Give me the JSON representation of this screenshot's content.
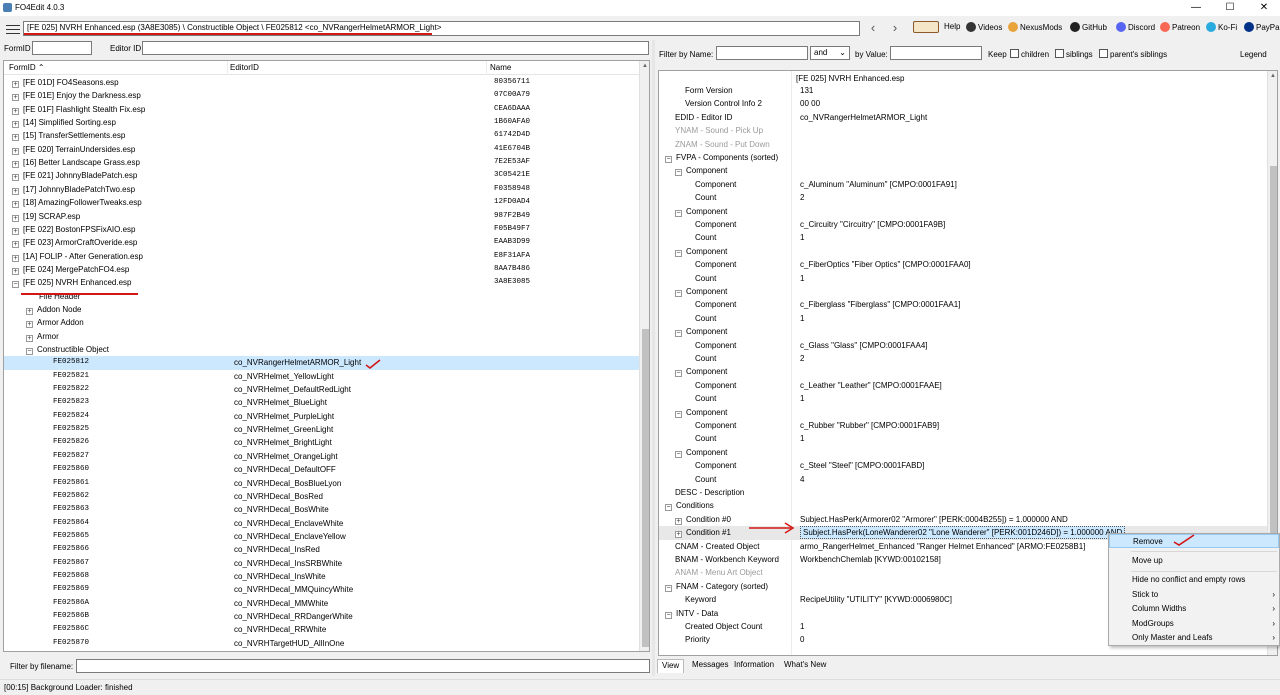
{
  "app": {
    "title": "FO4Edit 4.0.3",
    "controls": [
      "—",
      "☐",
      "✕"
    ]
  },
  "toolbar": {
    "path": "[FE 025] NVRH Enhanced.esp (3A8E3085) \\ Constructible Object \\ FE025812 <co_NVRangerHelmetARMOR_Light>",
    "links": [
      "Help",
      "Videos",
      "NexusMods",
      "GitHub",
      "Discord",
      "Patreon",
      "Ko-Fi",
      "PayPal"
    ],
    "link_icons": [
      "book-icon",
      "videos-icon",
      "nexusmods-icon",
      "github-icon",
      "discord-icon",
      "patreon-icon",
      "kofi-icon",
      "paypal-icon"
    ],
    "back_icon": "arrow-left-icon",
    "forward_icon": "arrow-right-icon"
  },
  "left_filter": {
    "formid_label": "FormID",
    "editorid_label": "Editor ID",
    "formid_value": "",
    "editorid_value": ""
  },
  "left_tree": {
    "headers": [
      "FormID",
      "EditorID",
      "Name"
    ],
    "plugins": [
      {
        "label": "[FE 01D] FO4Seasons.esp",
        "name": "80356711"
      },
      {
        "label": "[FE 01E] Enjoy the Darkness.esp",
        "name": "07C00A79"
      },
      {
        "label": "[FE 01F] Flashlight Stealth Fix.esp",
        "name": "CEA6DAAA"
      },
      {
        "label": "[14] Simplified Sorting.esp",
        "name": "1B60AFA0"
      },
      {
        "label": "[15] TransferSettlements.esp",
        "name": "61742D4D"
      },
      {
        "label": "[FE 020] TerrainUndersides.esp",
        "name": "41E6704B"
      },
      {
        "label": "[16] Better Landscape Grass.esp",
        "name": "7E2E53AF"
      },
      {
        "label": "[FE 021] JohnnyBladePatch.esp",
        "name": "3C05421E"
      },
      {
        "label": "[17] JohnnyBladePatchTwo.esp",
        "name": "F0358948"
      },
      {
        "label": "[18] AmazingFollowerTweaks.esp",
        "name": "12FD0AD4"
      },
      {
        "label": "[19] SCRAP.esp",
        "name": "987F2B49"
      },
      {
        "label": "[FE 022] BostonFPSFixAIO.esp",
        "name": "F05B49F7"
      },
      {
        "label": "[FE 023] ArmorCraftOveride.esp",
        "name": "EAAB3D99"
      },
      {
        "label": "[1A] FOLIP - After Generation.esp",
        "name": "E8F31AFA"
      },
      {
        "label": "[FE 024] MergePatchFO4.esp",
        "name": "8AA7B486"
      },
      {
        "label": "[FE 025] NVRH Enhanced.esp",
        "name": "3A8E3085"
      }
    ],
    "groups": [
      "File Header",
      "Addon Node",
      "Armor Addon",
      "Armor",
      "Constructible Object"
    ],
    "records": [
      {
        "formid": "FE025812",
        "editorid": "co_NVRangerHelmetARMOR_Light"
      },
      {
        "formid": "FE025821",
        "editorid": "co_NVRHelmet_YellowLight"
      },
      {
        "formid": "FE025822",
        "editorid": "co_NVRHelmet_DefaultRedLight"
      },
      {
        "formid": "FE025823",
        "editorid": "co_NVRHelmet_BlueLight"
      },
      {
        "formid": "FE025824",
        "editorid": "co_NVRHelmet_PurpleLight"
      },
      {
        "formid": "FE025825",
        "editorid": "co_NVRHelmet_GreenLight"
      },
      {
        "formid": "FE025826",
        "editorid": "co_NVRHelmet_BrightLight"
      },
      {
        "formid": "FE025827",
        "editorid": "co_NVRHelmet_OrangeLight"
      },
      {
        "formid": "FE025860",
        "editorid": "co_NVRHDecal_DefaultOFF"
      },
      {
        "formid": "FE025861",
        "editorid": "co_NVRHDecal_BosBlueLyon"
      },
      {
        "formid": "FE025862",
        "editorid": "co_NVRHDecal_BosRed"
      },
      {
        "formid": "FE025863",
        "editorid": "co_NVRHDecal_BosWhite"
      },
      {
        "formid": "FE025864",
        "editorid": "co_NVRHDecal_EnclaveWhite"
      },
      {
        "formid": "FE025865",
        "editorid": "co_NVRHDecal_EnclaveYellow"
      },
      {
        "formid": "FE025866",
        "editorid": "co_NVRHDecal_InsRed"
      },
      {
        "formid": "FE025867",
        "editorid": "co_NVRHDecal_InsSRBWhite"
      },
      {
        "formid": "FE025868",
        "editorid": "co_NVRHDecal_InsWhite"
      },
      {
        "formid": "FE025869",
        "editorid": "co_NVRHDecal_MMQuincyWhite"
      },
      {
        "formid": "FE02586A",
        "editorid": "co_NVRHDecal_MMWhite"
      },
      {
        "formid": "FE02586B",
        "editorid": "co_NVRHDecal_RRDangerWhite"
      },
      {
        "formid": "FE02586C",
        "editorid": "co_NVRHDecal_RRWhite"
      },
      {
        "formid": "FE025870",
        "editorid": "co_NVRHTargetHUD_AllInOne"
      }
    ]
  },
  "left_bottom": {
    "filter_label": "Filter by filename:",
    "filter_value": ""
  },
  "status": {
    "text": "[00:15] Background Loader: finished"
  },
  "right_filter": {
    "name_label": "Filter by Name:",
    "name_value": "",
    "op_value": "and",
    "value_label": "by Value:",
    "value_value": "",
    "keep_label": "Keep",
    "children_label": "children",
    "siblings_label": "siblings",
    "parents_siblings_label": "parent's siblings",
    "legend_label": "Legend"
  },
  "right_view": {
    "header_value": "[FE 025] NVRH Enhanced.esp",
    "rows": [
      {
        "label": "Form Version",
        "value": "131",
        "indent": 2,
        "exp": "",
        "gray": false
      },
      {
        "label": "Version Control Info 2",
        "value": "00 00",
        "indent": 2,
        "exp": "",
        "gray": false
      },
      {
        "label": "EDID - Editor ID",
        "value": "co_NVRangerHelmetARMOR_Light",
        "indent": 1,
        "exp": "",
        "gray": false
      },
      {
        "label": "YNAM - Sound - Pick Up",
        "value": "",
        "indent": 1,
        "exp": "",
        "gray": true
      },
      {
        "label": "ZNAM - Sound - Put Down",
        "value": "",
        "indent": 1,
        "exp": "",
        "gray": true
      },
      {
        "label": "FVPA - Components (sorted)",
        "value": "",
        "indent": 0,
        "exp": "−",
        "gray": false
      },
      {
        "label": "Component",
        "value": "",
        "indent": 1,
        "exp": "−",
        "gray": false
      },
      {
        "label": "Component",
        "value": "c_Aluminum \"Aluminum\" [CMPO:0001FA91]",
        "indent": 3,
        "exp": "",
        "gray": false
      },
      {
        "label": "Count",
        "value": "2",
        "indent": 3,
        "exp": "",
        "gray": false
      },
      {
        "label": "Component",
        "value": "",
        "indent": 1,
        "exp": "−",
        "gray": false
      },
      {
        "label": "Component",
        "value": "c_Circuitry \"Circuitry\" [CMPO:0001FA9B]",
        "indent": 3,
        "exp": "",
        "gray": false
      },
      {
        "label": "Count",
        "value": "1",
        "indent": 3,
        "exp": "",
        "gray": false
      },
      {
        "label": "Component",
        "value": "",
        "indent": 1,
        "exp": "−",
        "gray": false
      },
      {
        "label": "Component",
        "value": "c_FiberOptics \"Fiber Optics\" [CMPO:0001FAA0]",
        "indent": 3,
        "exp": "",
        "gray": false
      },
      {
        "label": "Count",
        "value": "1",
        "indent": 3,
        "exp": "",
        "gray": false
      },
      {
        "label": "Component",
        "value": "",
        "indent": 1,
        "exp": "−",
        "gray": false
      },
      {
        "label": "Component",
        "value": "c_Fiberglass \"Fiberglass\" [CMPO:0001FAA1]",
        "indent": 3,
        "exp": "",
        "gray": false
      },
      {
        "label": "Count",
        "value": "1",
        "indent": 3,
        "exp": "",
        "gray": false
      },
      {
        "label": "Component",
        "value": "",
        "indent": 1,
        "exp": "−",
        "gray": false
      },
      {
        "label": "Component",
        "value": "c_Glass \"Glass\" [CMPO:0001FAA4]",
        "indent": 3,
        "exp": "",
        "gray": false
      },
      {
        "label": "Count",
        "value": "2",
        "indent": 3,
        "exp": "",
        "gray": false
      },
      {
        "label": "Component",
        "value": "",
        "indent": 1,
        "exp": "−",
        "gray": false
      },
      {
        "label": "Component",
        "value": "c_Leather \"Leather\" [CMPO:0001FAAE]",
        "indent": 3,
        "exp": "",
        "gray": false
      },
      {
        "label": "Count",
        "value": "1",
        "indent": 3,
        "exp": "",
        "gray": false
      },
      {
        "label": "Component",
        "value": "",
        "indent": 1,
        "exp": "−",
        "gray": false
      },
      {
        "label": "Component",
        "value": "c_Rubber \"Rubber\" [CMPO:0001FAB9]",
        "indent": 3,
        "exp": "",
        "gray": false
      },
      {
        "label": "Count",
        "value": "1",
        "indent": 3,
        "exp": "",
        "gray": false
      },
      {
        "label": "Component",
        "value": "",
        "indent": 1,
        "exp": "−",
        "gray": false
      },
      {
        "label": "Component",
        "value": "c_Steel \"Steel\" [CMPO:0001FABD]",
        "indent": 3,
        "exp": "",
        "gray": false
      },
      {
        "label": "Count",
        "value": "4",
        "indent": 3,
        "exp": "",
        "gray": false
      },
      {
        "label": "DESC - Description",
        "value": "",
        "indent": 1,
        "exp": "",
        "gray": false
      },
      {
        "label": "Conditions",
        "value": "",
        "indent": 0,
        "exp": "−",
        "gray": false
      },
      {
        "label": "Condition #0",
        "value": "Subject.HasPerk(Armorer02 \"Armorer\" [PERK:0004B255]) = 1.000000 AND",
        "indent": 1,
        "exp": "+",
        "gray": false
      },
      {
        "label": "Condition #1",
        "value": "Subject.HasPerk(LoneWanderer02 \"Lone Wanderer\" [PERK:001D246D]) = 1.000000 AND",
        "indent": 1,
        "exp": "+",
        "gray": false
      },
      {
        "label": "CNAM - Created Object",
        "value": "armo_RangerHelmet_Enhanced \"Ranger Helmet Enhanced\" [ARMO:FE0258B1]",
        "indent": 1,
        "exp": "",
        "gray": false
      },
      {
        "label": "BNAM - Workbench Keyword",
        "value": "WorkbenchChemlab [KYWD:00102158]",
        "indent": 1,
        "exp": "",
        "gray": false
      },
      {
        "label": "ANAM - Menu Art Object",
        "value": "",
        "indent": 1,
        "exp": "",
        "gray": true
      },
      {
        "label": "FNAM - Category (sorted)",
        "value": "",
        "indent": 0,
        "exp": "−",
        "gray": false
      },
      {
        "label": "Keyword",
        "value": "RecipeUtility \"UTILITY\" [KYWD:0006980C]",
        "indent": 2,
        "exp": "",
        "gray": false
      },
      {
        "label": "INTV - Data",
        "value": "",
        "indent": 0,
        "exp": "−",
        "gray": false
      },
      {
        "label": "Created Object Count",
        "value": "1",
        "indent": 2,
        "exp": "",
        "gray": false
      },
      {
        "label": "Priority",
        "value": "0",
        "indent": 2,
        "exp": "",
        "gray": false
      }
    ]
  },
  "tabs": [
    "View",
    "Messages",
    "Information",
    "What's New"
  ],
  "context_menu": [
    {
      "label": "Remove",
      "submenu": false
    },
    {
      "label": "Move up",
      "submenu": false
    },
    {
      "label": "Hide no conflict and empty rows",
      "submenu": false
    },
    {
      "label": "Stick to",
      "submenu": true
    },
    {
      "label": "Column Widths",
      "submenu": true
    },
    {
      "label": "ModGroups",
      "submenu": true
    },
    {
      "label": "Only Master and Leafs",
      "submenu": true
    }
  ],
  "colors": {
    "annotation_red": "#d31616",
    "selection": "#cce8ff",
    "selection_border": "#99c9ef"
  }
}
